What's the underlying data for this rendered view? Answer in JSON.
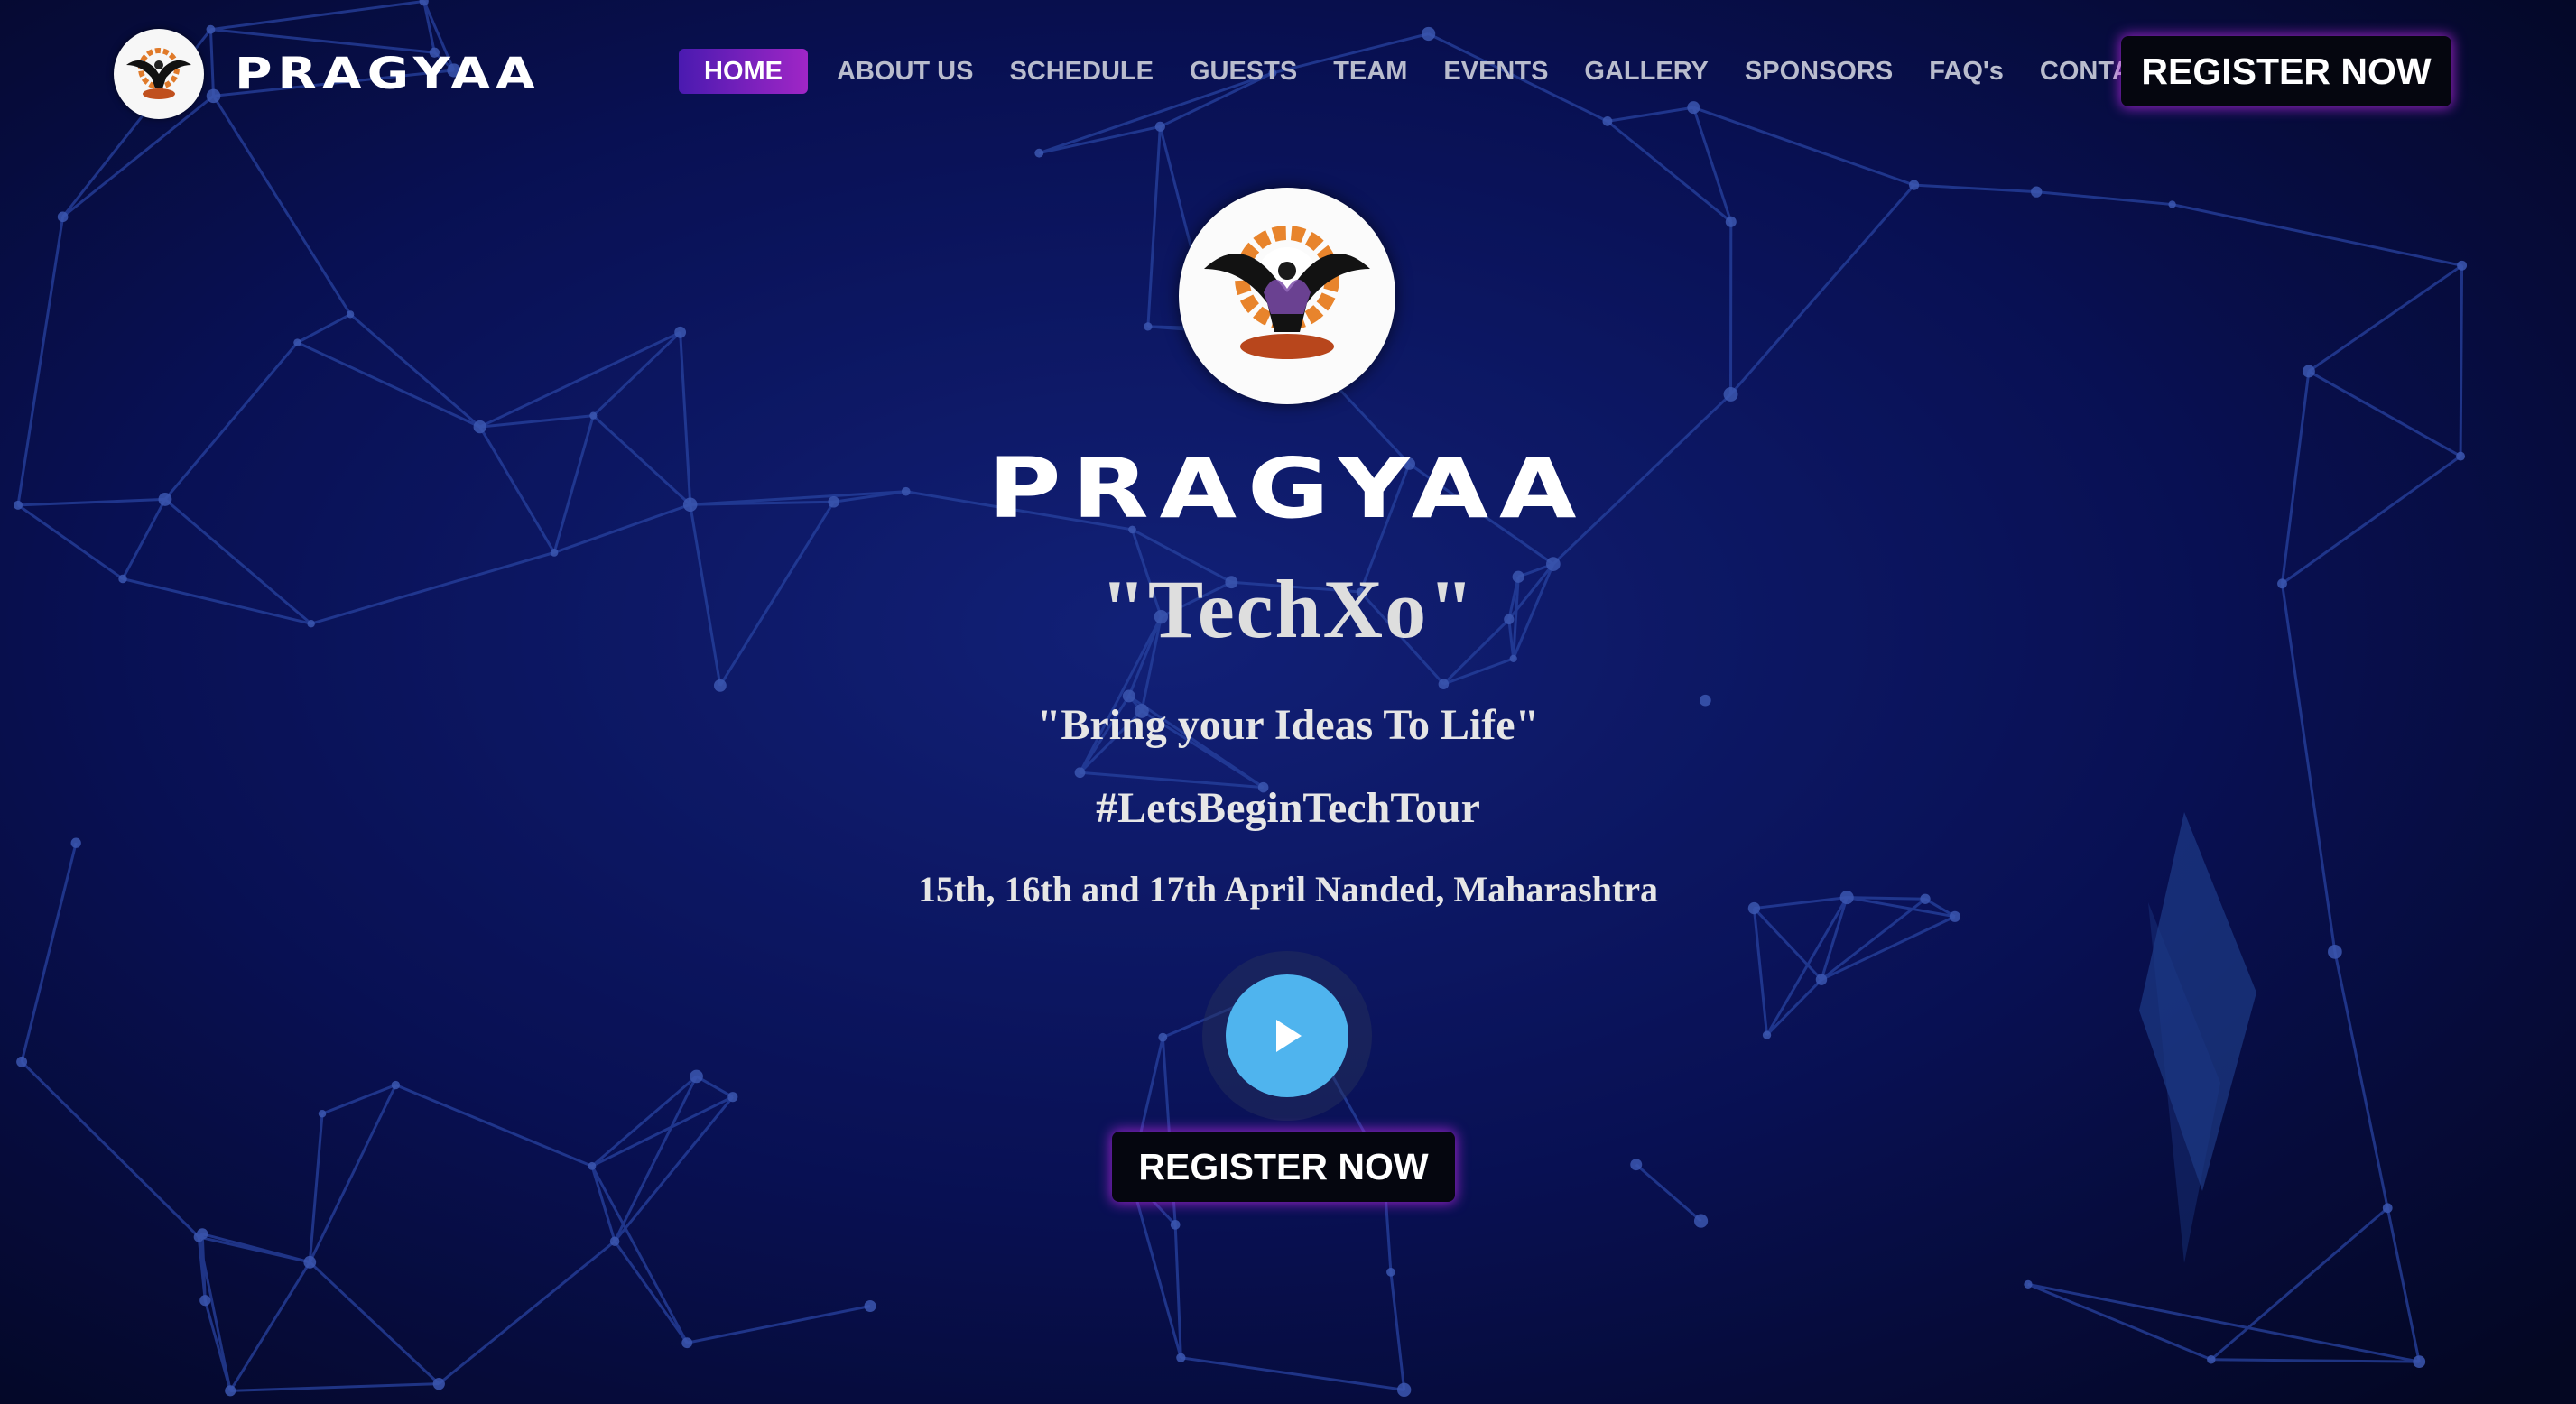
{
  "brand": {
    "name": "PRAGYAA"
  },
  "nav": {
    "items": [
      {
        "label": "HOME",
        "active": true
      },
      {
        "label": "ABOUT US"
      },
      {
        "label": "SCHEDULE"
      },
      {
        "label": "GUESTS"
      },
      {
        "label": "TEAM"
      },
      {
        "label": "EVENTS"
      },
      {
        "label": "GALLERY"
      },
      {
        "label": "SPONSORS"
      },
      {
        "label": "FAQ's"
      },
      {
        "label": "CONTACT"
      }
    ],
    "register_label": "REGISTER NOW"
  },
  "hero": {
    "brand": "PRAGYAA",
    "title": "\"TechXo\"",
    "tagline": "\"Bring your Ideas To Life\"",
    "hashtag": "#LetsBeginTechTour",
    "date": "15th, 16th and 17th April Nanded, Maharashtra",
    "play_icon": "play-icon",
    "register_label": "REGISTER NOW"
  },
  "colors": {
    "background": "#060a2a",
    "network_line": "#3b63e6",
    "accent_purple": "#a026c6",
    "play_blue": "#4fb4ee"
  }
}
